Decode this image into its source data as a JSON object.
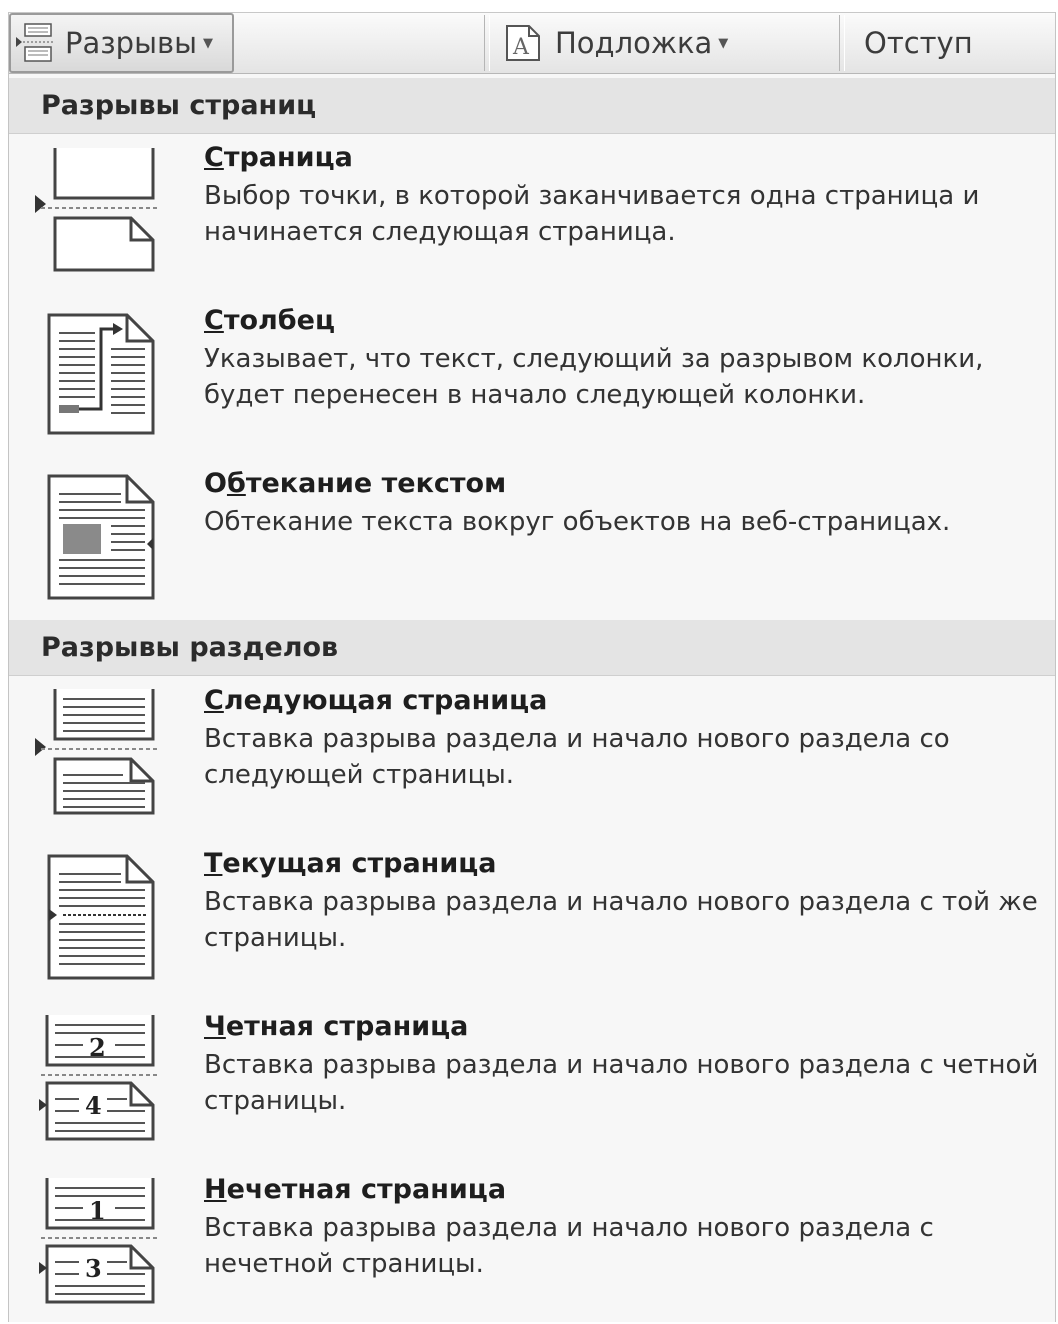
{
  "ribbon": {
    "breaks_label": "Разрывы",
    "watermark_label": "Подложка",
    "indent_label": "Отступ"
  },
  "page_breaks": {
    "header": "Разрывы страниц",
    "items": [
      {
        "title_access": "С",
        "title_rest": "траница",
        "description": "Выбор точки, в которой заканчивается одна страница и начинается следующая страница."
      },
      {
        "title_access": "С",
        "title_rest": "толбец",
        "description": "Указывает, что текст, следующий за разрывом колонки, будет перенесен в начало следующей колонки."
      },
      {
        "title_pre": "О",
        "title_access": "б",
        "title_rest": "текание текстом",
        "description": "Обтекание текста вокруг объектов на веб-страницах."
      }
    ]
  },
  "section_breaks": {
    "header": "Разрывы разделов",
    "items": [
      {
        "title_access": "С",
        "title_rest": "ледующая страница",
        "description": "Вставка разрыва раздела и начало нового раздела со следующей страницы."
      },
      {
        "title_access": "Т",
        "title_rest": "екущая страница",
        "description": "Вставка разрыва раздела и начало нового раздела с той же страницы."
      },
      {
        "title_access": "Ч",
        "title_rest": "етная страница",
        "description": "Вставка разрыва раздела и начало нового раздела с четной страницы.",
        "icon_numbers": [
          "2",
          "4"
        ]
      },
      {
        "title_access": "Н",
        "title_rest": "ечетная страница",
        "description": "Вставка разрыва раздела и начало нового раздела с нечетной страницы.",
        "icon_numbers": [
          "1",
          "3"
        ]
      }
    ]
  }
}
